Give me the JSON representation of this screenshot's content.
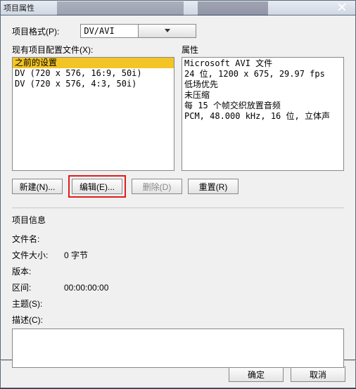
{
  "window": {
    "title": "项目属性"
  },
  "format": {
    "label": "项目格式(P):",
    "value": "DV/AVI"
  },
  "profiles": {
    "label": "现有项目配置文件(X):",
    "items": [
      {
        "text": "之前的设置",
        "selected": true
      },
      {
        "text": "DV (720 x 576, 16:9, 50i)"
      },
      {
        "text": "DV (720 x 576, 4:3, 50i)"
      }
    ]
  },
  "attributes": {
    "label": "属性",
    "lines": [
      "Microsoft AVI 文件",
      "24 位, 1200 x 675, 29.97 fps",
      "低场优先",
      "未压缩",
      "每 15 个帧交织放置音频",
      "PCM, 48.000 kHz, 16 位, 立体声"
    ]
  },
  "buttons": {
    "new": "新建(N)...",
    "edit": "编辑(E)...",
    "delete": "删除(D)",
    "reset": "重置(R)",
    "ok": "确定",
    "cancel": "取消"
  },
  "info": {
    "heading": "项目信息",
    "filename_label": "文件名:",
    "filename_value": "",
    "filesize_label": "文件大小:",
    "filesize_value": "0 字节",
    "version_label": "版本:",
    "version_value": "",
    "range_label": "区间:",
    "range_value": "00:00:00:00",
    "subject_label": "主题(S):",
    "subject_value": "",
    "desc_label": "描述(C):"
  }
}
